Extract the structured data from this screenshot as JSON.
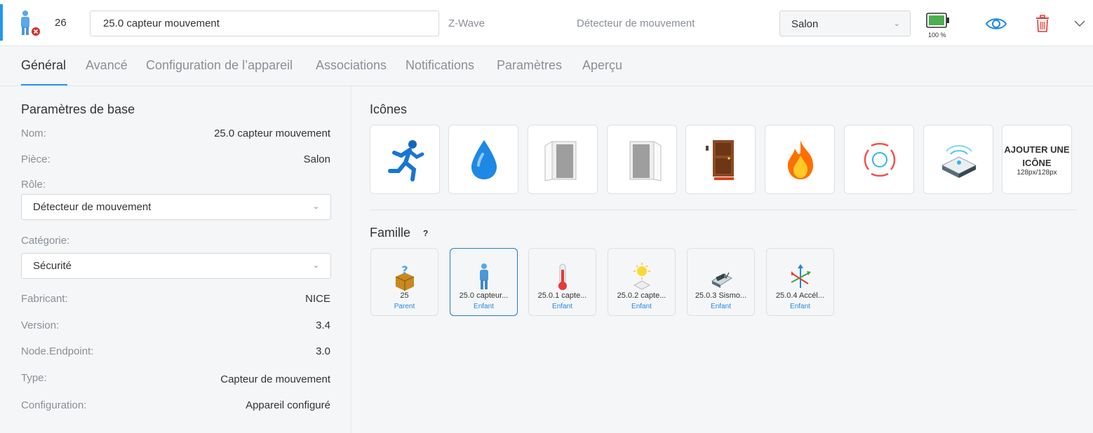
{
  "header": {
    "device_id": "26",
    "name_value": "25.0 capteur mouvement",
    "protocol": "Z-Wave",
    "device_type": "Détecteur de mouvement",
    "room": "Salon",
    "battery_label": "100 %",
    "battery_level": 1.0,
    "icons": {
      "device": "person-icon",
      "status": "error-badge-icon",
      "view": "eye-icon",
      "delete": "trash-icon",
      "collapse": "chevron-down-icon"
    },
    "colors": {
      "accent": "#2196f3",
      "battery": "#4caf50",
      "delete": "#e53935"
    }
  },
  "tabs": [
    {
      "label": "Général",
      "active": true
    },
    {
      "label": "Avancé"
    },
    {
      "label": "Configuration de l’appareil"
    },
    {
      "label": "Associations"
    },
    {
      "label": "Notifications"
    },
    {
      "label": "Paramètres"
    },
    {
      "label": "Aperçu"
    }
  ],
  "basic": {
    "title": "Paramètres de base",
    "name_label": "Nom:",
    "name_value": "25.0 capteur mouvement",
    "room_label": "Pièce:",
    "room_value": "Salon",
    "role_label": "Rôle:",
    "role_value": "Détecteur de mouvement",
    "category_label": "Catégorie:",
    "category_value": "Sécurité",
    "manufacturer_label": "Fabricant:",
    "manufacturer_value": "NICE",
    "version_label": "Version:",
    "version_value": "3.4",
    "endpoint_label": "Node.Endpoint:",
    "endpoint_value": "3.0",
    "type_label": "Type:",
    "type_value": "Capteur de mouvement",
    "config_label": "Configuration:",
    "config_value": "Appareil configuré"
  },
  "icons_section": {
    "title": "Icônes",
    "items": [
      "running-person-icon",
      "water-drop-icon",
      "door-open-icon",
      "door-open-right-icon",
      "wooden-door-icon",
      "fire-icon",
      "alarm-ring-icon",
      "sensor-device-icon"
    ],
    "add_title": "AJOUTER UNE ICÔNE",
    "add_size": "128px/128px"
  },
  "family": {
    "title": "Famille",
    "help": "?",
    "items": [
      {
        "name": "25",
        "relation": "Parent",
        "icon": "box-question-icon"
      },
      {
        "name": "25.0 capteur...",
        "relation": "Enfant",
        "icon": "person-icon",
        "selected": true
      },
      {
        "name": "25.0.1 capte...",
        "relation": "Enfant",
        "icon": "thermometer-icon"
      },
      {
        "name": "25.0.2 capte...",
        "relation": "Enfant",
        "icon": "light-sensor-icon"
      },
      {
        "name": "25.0.3 Sismo...",
        "relation": "Enfant",
        "icon": "seismometer-icon"
      },
      {
        "name": "25.0.4 Accél...",
        "relation": "Enfant",
        "icon": "accelerometer-icon"
      }
    ]
  }
}
